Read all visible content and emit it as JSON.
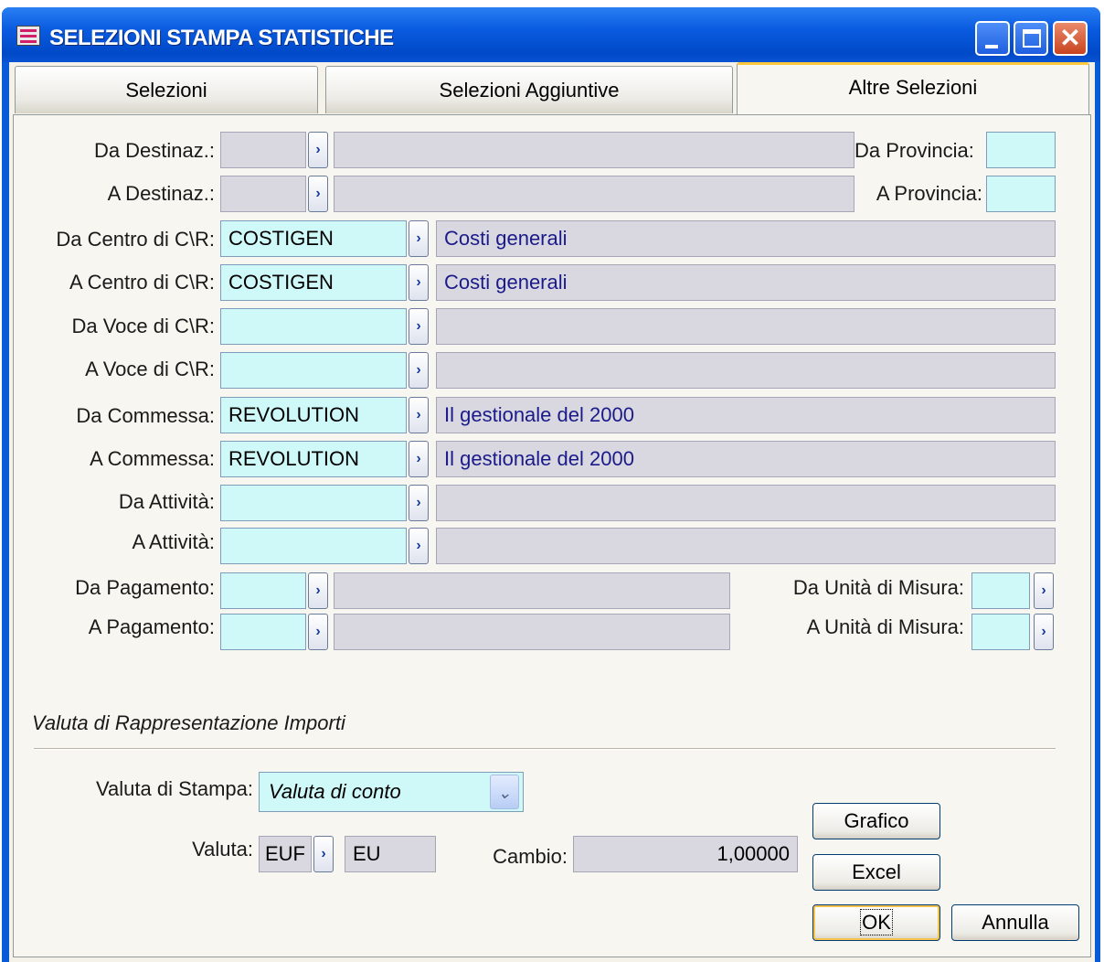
{
  "window": {
    "title": "SELEZIONI STAMPA STATISTICHE",
    "close_glyph": "✕"
  },
  "tabs": [
    {
      "label": "Selezioni"
    },
    {
      "label": "Selezioni Aggiuntive"
    },
    {
      "label": "Altre Selezioni",
      "active": true
    }
  ],
  "lookup_glyph": "›",
  "fields": {
    "da_destinaz": {
      "label": "Da Destinaz.:",
      "code": "",
      "desc": ""
    },
    "a_destinaz": {
      "label": "A Destinaz.:",
      "code": "",
      "desc": ""
    },
    "da_provincia": {
      "label": "Da Provincia:",
      "value": ""
    },
    "a_provincia": {
      "label": "A Provincia:",
      "value": ""
    },
    "da_centro": {
      "label": "Da Centro di C\\R:",
      "code": "COSTIGEN",
      "desc": "Costi generali"
    },
    "a_centro": {
      "label": "A Centro di C\\R:",
      "code": "COSTIGEN",
      "desc": "Costi generali"
    },
    "da_voce": {
      "label": "Da Voce di C\\R:",
      "code": "",
      "desc": ""
    },
    "a_voce": {
      "label": "A Voce di C\\R:",
      "code": "",
      "desc": ""
    },
    "da_commessa": {
      "label": "Da Commessa:",
      "code": "REVOLUTION",
      "desc": "Il gestionale del 2000"
    },
    "a_commessa": {
      "label": "A Commessa:",
      "code": "REVOLUTION",
      "desc": "Il gestionale del 2000"
    },
    "da_attivita": {
      "label": "Da Attività:",
      "code": "",
      "desc": ""
    },
    "a_attivita": {
      "label": "A Attività:",
      "code": "",
      "desc": ""
    },
    "da_pagamento": {
      "label": "Da Pagamento:",
      "code": "",
      "desc": ""
    },
    "a_pagamento": {
      "label": "A Pagamento:",
      "code": "",
      "desc": ""
    },
    "da_um": {
      "label": "Da Unità di Misura:",
      "value": ""
    },
    "a_um": {
      "label": "A Unità di Misura:",
      "value": ""
    }
  },
  "valuta_section": {
    "heading": "Valuta di Rappresentazione Importi",
    "stampa_label": "Valuta di Stampa:",
    "stampa_value": "Valuta di conto",
    "combo_glyph": "⌄",
    "valuta_label": "Valuta:",
    "valuta_code": "EUF",
    "valuta_desc": "EU",
    "cambio_label": "Cambio:",
    "cambio_value": "1,00000"
  },
  "buttons": {
    "grafico": "Grafico",
    "excel": "Excel",
    "ok": "OK",
    "annulla": "Annulla"
  }
}
